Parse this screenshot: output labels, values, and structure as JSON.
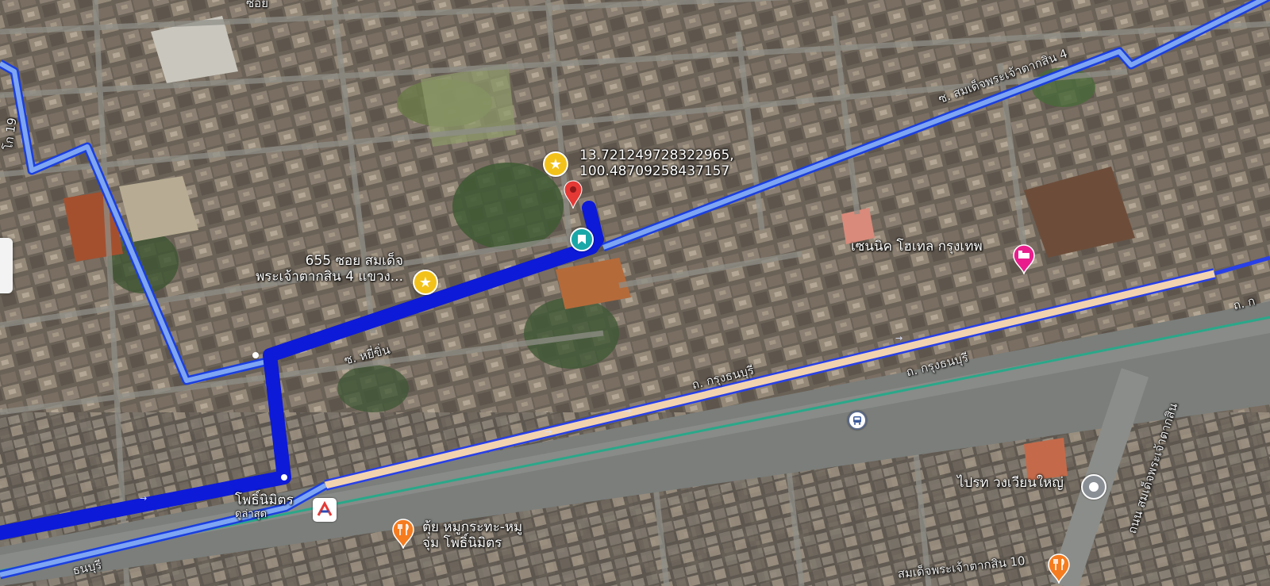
{
  "map": {
    "view": "satellite",
    "colors": {
      "route_active": "#1a1ae6",
      "route_alt": "#6a9cf0",
      "road_beige": "#f2d3b0",
      "rail_green": "#2aa889",
      "pin_star": "#f3c21a",
      "pin_red": "#e53935",
      "pin_teal": "#1aa7a7",
      "pin_hotel": "#e91e8c",
      "pin_food": "#f57c1f",
      "pin_transit": "#e53935"
    }
  },
  "labels": {
    "coords_line1": "13.721249728322965,",
    "coords_line2": "100.48709258437157",
    "address_line1": "655 ซอย สมเด็จ",
    "address_line2": "พระเจ้าตากสิน 4 แขวง...",
    "street_somdet4": "ซ. สมเด็จพระเจ้าตากสิน 4",
    "street_hatsai": "ซ. หยี่ขิ่น",
    "road_krung_thonburi_1": "ถ. กรุงธนบุรี",
    "road_krung_thonburi_2": "ถ. กรุงธนบุรี",
    "road_krung_edge": "ถ. ก",
    "road_somdet_main": "ถนน สมเด็จพระเจ้าตากสิน",
    "road_somdet10": "สมเด็จพระเจ้าตากสิน 10",
    "road_bottom_left": "ธนบุรี",
    "road_top_left": "ซอย",
    "road_left_vertical": "โก 19",
    "hotel_name": "เซนนิค โฮเทล กรุงเทพ",
    "station_name": "โพธิ์นิมิตร",
    "station_sub": "ดูล่าสุด",
    "restaurant_line1": "ตุ้ย หมูกระทะ-หมู",
    "restaurant_line2": "จุ่ม โพธิ์นิมิตร",
    "landmark_name": "ไปรท วงเวียนใหญ่"
  },
  "icons": {
    "star_pin": "star-icon",
    "red_marker": "red-location-marker",
    "teal_pin": "bookmark-icon",
    "hotel_pin": "bed-icon",
    "station_pin": "train-station-icon",
    "restaurant_pin": "fork-knife-icon",
    "transit_pin": "bus-icon",
    "landmark_pin": "location-circle-icon"
  }
}
